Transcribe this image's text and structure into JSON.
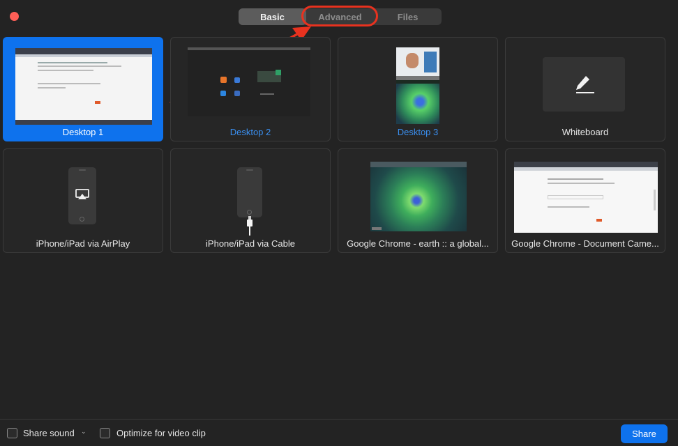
{
  "tabs": [
    {
      "label": "Basic",
      "active": true
    },
    {
      "label": "Advanced",
      "active": false
    },
    {
      "label": "Files",
      "active": false
    }
  ],
  "tiles": [
    {
      "label": "Desktop 1",
      "selected": true
    },
    {
      "label": "Desktop 2",
      "selected": false
    },
    {
      "label": "Desktop 3",
      "selected": false
    },
    {
      "label": "Whiteboard",
      "selected": false
    },
    {
      "label": "iPhone/iPad via AirPlay",
      "selected": false
    },
    {
      "label": "iPhone/iPad via Cable",
      "selected": false
    },
    {
      "label": "Google Chrome - earth :: a global...",
      "selected": false
    },
    {
      "label": "Google Chrome - Document Came...",
      "selected": false
    }
  ],
  "footer": {
    "share_sound": "Share sound",
    "optimize_video": "Optimize for video clip",
    "share_button": "Share"
  },
  "colors": {
    "accent": "#0e72ed",
    "annotation": "#e8321f",
    "close": "#fe5f57"
  },
  "icons": {
    "whiteboard": "pencil-icon",
    "airplay": "airplay-icon",
    "cable": "lightning-cable-icon"
  }
}
